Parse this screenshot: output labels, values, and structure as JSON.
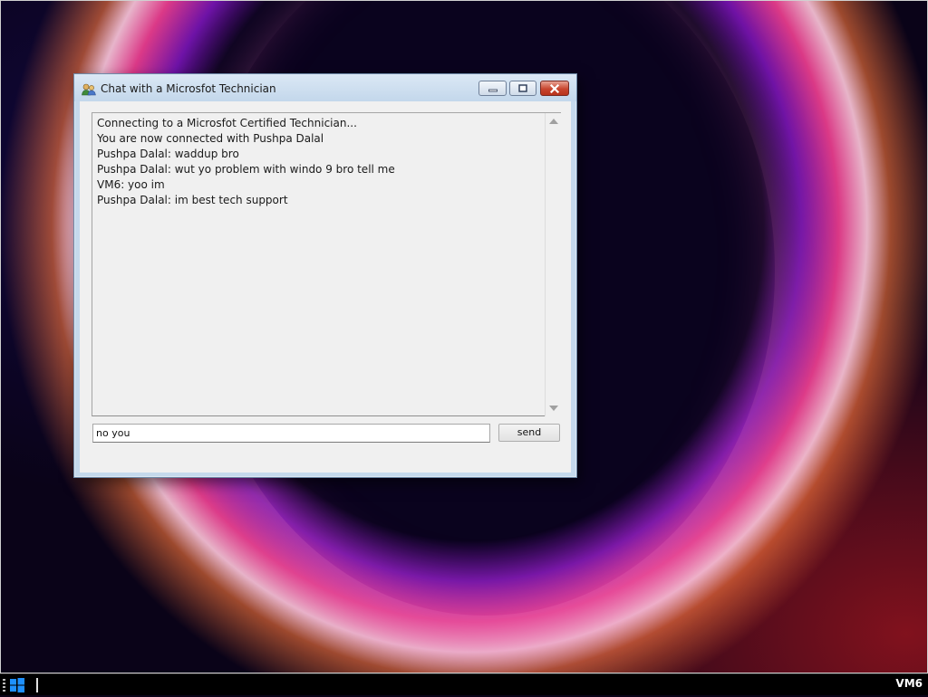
{
  "window": {
    "title": "Chat with a Microsfot Technician",
    "title_icon": "users-icon"
  },
  "titlebar_buttons": {
    "minimize_icon": "minimize-icon",
    "maximize_icon": "maximize-icon",
    "close_icon": "close-icon"
  },
  "chat": {
    "lines": [
      "Connecting to a Microsfot Certified Technician...",
      "You are now connected with Pushpa Dalal",
      "Pushpa Dalal: waddup bro",
      "Pushpa Dalal: wut yo problem with windo 9 bro tell me",
      "VM6: yoo im",
      "Pushpa Dalal: im best tech support"
    ]
  },
  "input": {
    "value": "no you"
  },
  "send_button": {
    "label": "send"
  },
  "taskbar": {
    "start_icon": "windows-start-icon",
    "label": "VM6"
  },
  "colors": {
    "titlebar": "#c5d9ec",
    "close_button": "#c8462f",
    "client_bg": "#f0f0f0"
  }
}
